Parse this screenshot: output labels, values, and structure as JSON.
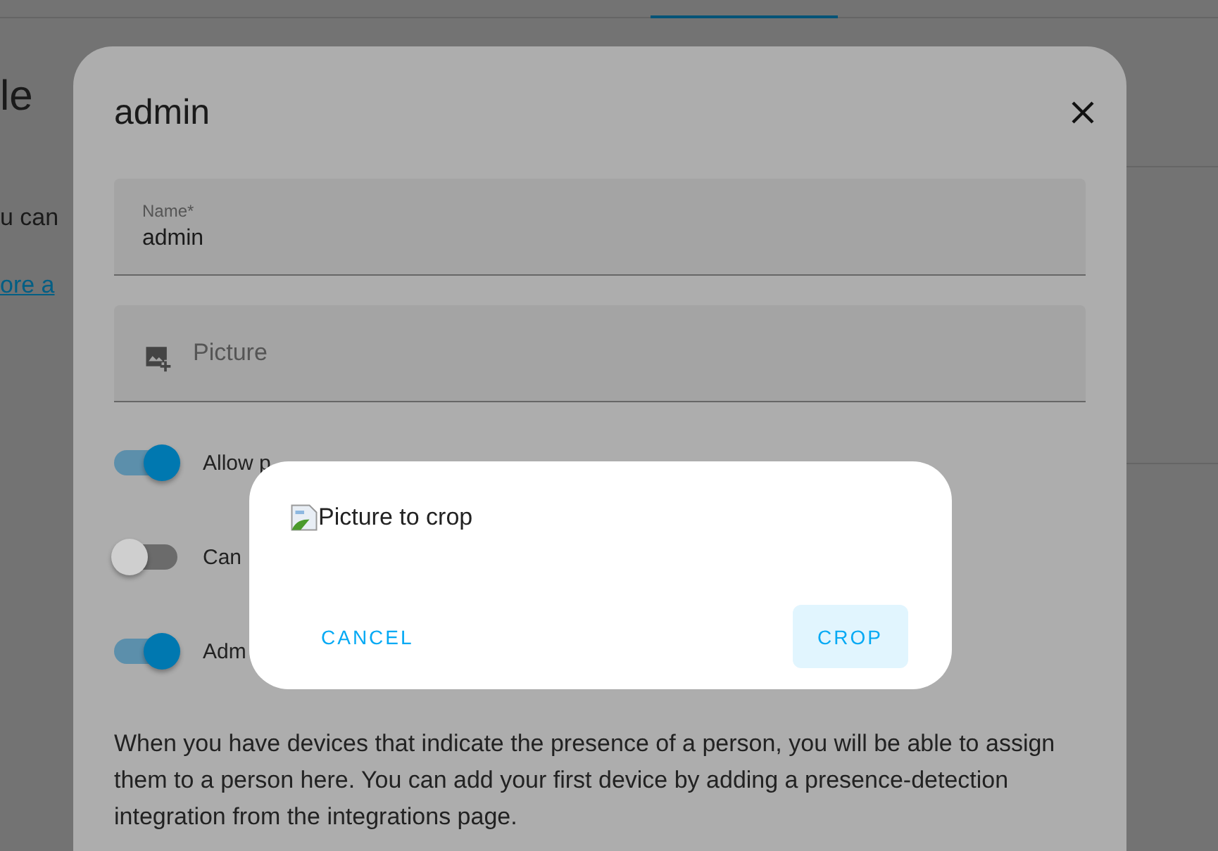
{
  "background_page": {
    "heading": "le",
    "text": "u can",
    "link": "ore a"
  },
  "dialog": {
    "title": "admin",
    "name_field": {
      "label": "Name*",
      "value": "admin"
    },
    "picture_field": {
      "placeholder": "Picture"
    },
    "toggles": [
      {
        "label": "Allow p",
        "on": true
      },
      {
        "label": "Can",
        "on": false
      },
      {
        "label": "Adm",
        "on": true
      }
    ],
    "description": "When you have devices that indicate the presence of a person, you will be able to assign them to a person here. You can add your first device by adding a presence-detection integration from the integrations page."
  },
  "crop_dialog": {
    "image_alt": "Picture to crop",
    "buttons": [
      {
        "label": "CANCEL",
        "kind": "text"
      },
      {
        "label": "CROP",
        "kind": "tonal"
      }
    ]
  }
}
